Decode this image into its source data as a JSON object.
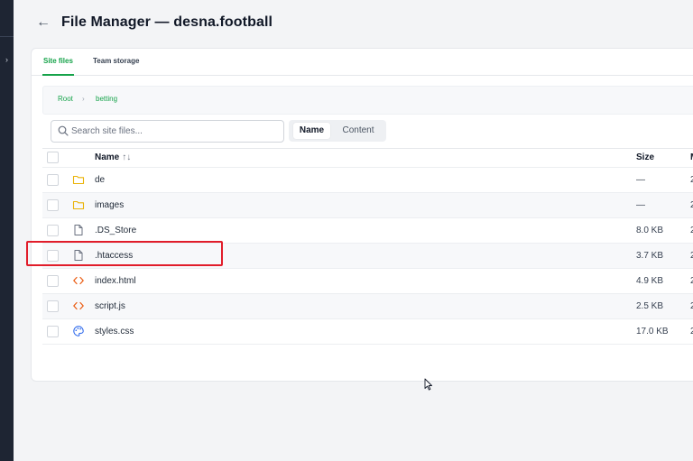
{
  "header": {
    "title": "File Manager — desna.football"
  },
  "tabs": [
    {
      "label": "Site files",
      "active": true
    },
    {
      "label": "Team storage",
      "active": false
    }
  ],
  "breadcrumb": {
    "root": "Root",
    "current": "betting"
  },
  "search": {
    "placeholder": "Search site files..."
  },
  "search_mode": {
    "options": [
      "Name",
      "Content"
    ],
    "selected": "Name"
  },
  "table": {
    "columns": {
      "name": "Name",
      "sort": "↑↓",
      "size": "Size",
      "modified": "M"
    },
    "rows": [
      {
        "icon": "folder-icon",
        "name": "de",
        "size": "—",
        "modified": "2"
      },
      {
        "icon": "folder-icon",
        "name": "images",
        "size": "—",
        "modified": "2"
      },
      {
        "icon": "file-icon",
        "name": ".DS_Store",
        "size": "8.0 KB",
        "modified": "2"
      },
      {
        "icon": "file-icon",
        "name": ".htaccess",
        "size": "3.7 KB",
        "modified": "2"
      },
      {
        "icon": "code-icon",
        "name": "index.html",
        "size": "4.9 KB",
        "modified": "2"
      },
      {
        "icon": "code-icon",
        "name": "script.js",
        "size": "2.5 KB",
        "modified": "2"
      },
      {
        "icon": "palette-icon",
        "name": "styles.css",
        "size": "17.0 KB",
        "modified": "2"
      }
    ]
  },
  "colors": {
    "accent": "#16a34a",
    "folder": "#eab308",
    "code": "#ea580c",
    "palette": "#2563eb",
    "highlight": "#e11d2a"
  }
}
